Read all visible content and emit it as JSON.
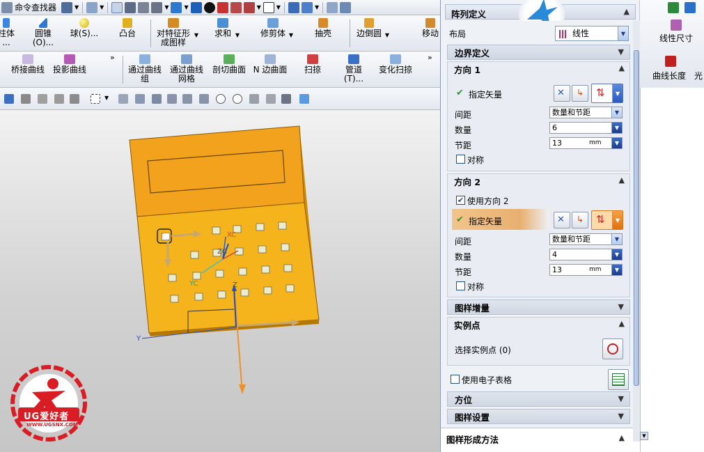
{
  "toolbar_top": {
    "command_finder": "命令查找器"
  },
  "ribbon_row1": {
    "tools": [
      {
        "label": "柱体\n..."
      },
      {
        "label": "圆锥\n(O)..."
      },
      {
        "label": "球(S)..."
      },
      {
        "label": "凸台"
      },
      {
        "label": "对特征形\n成图样"
      },
      {
        "label": "求和"
      },
      {
        "label": "修剪体"
      },
      {
        "label": "抽壳"
      },
      {
        "label": "边倒圆"
      },
      {
        "label": "移动"
      }
    ]
  },
  "ribbon_row2": {
    "tools": [
      {
        "label": "桥接曲线"
      },
      {
        "label": "投影曲线"
      },
      {
        "label": "通过曲线\n组"
      },
      {
        "label": "通过曲线\n网格"
      },
      {
        "label": "剖切曲面"
      },
      {
        "label": "N 边曲面"
      },
      {
        "label": "扫掠"
      },
      {
        "label": "管道\n(T)..."
      },
      {
        "label": "变化扫掠"
      }
    ]
  },
  "right_toolbar": {
    "tool1": "线性尺寸",
    "tool2": "曲线长度",
    "tool3": "光"
  },
  "model": {
    "axis_xc": "XC",
    "axis_yc": "YC",
    "axis_zc": "ZC",
    "axis_y": "Y",
    "axis_z": "Z"
  },
  "watermark": {
    "brand": "UG爱好者",
    "url": "WWW.UGSNX.COM"
  },
  "dialog": {
    "title": "阵列定义",
    "layout_label": "布局",
    "layout_value": "线性",
    "boundary_section": "边界定义",
    "dir1": {
      "header": "方向 1",
      "vector_label": "指定矢量",
      "spacing_label": "间距",
      "spacing_value": "数量和节距",
      "count_label": "数量",
      "count_value": "6",
      "pitch_label": "节距",
      "pitch_value": "13",
      "pitch_unit": "mm",
      "symmetric_label": "对称"
    },
    "dir2": {
      "header": "方向 2",
      "use_dir2_label": "使用方向 2",
      "vector_label": "指定矢量",
      "spacing_label": "间距",
      "spacing_value": "数量和节距",
      "count_label": "数量",
      "count_value": "4",
      "pitch_label": "节距",
      "pitch_value": "13",
      "pitch_unit": "mm",
      "symmetric_label": "对称"
    },
    "pattern_increment": "图样增量",
    "instance_points": {
      "header": "实例点",
      "select_label": "选择实例点 (0)"
    },
    "use_spreadsheet": "使用电子表格",
    "orientation": "方位",
    "pattern_settings": "图样设置",
    "method_section": "图样形成方法"
  }
}
